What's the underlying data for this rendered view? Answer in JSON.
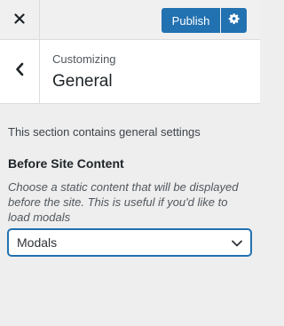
{
  "topbar": {
    "publish_label": "Publish",
    "close_icon": "close-icon",
    "settings_icon": "gear-icon",
    "accent_color": "#2271b1"
  },
  "section": {
    "breadcrumb": "Customizing",
    "title": "General",
    "back_icon": "chevron-left-icon"
  },
  "content": {
    "description": "This section contains general settings",
    "field_label": "Before Site Content",
    "field_help": "Choose a static content that will be displayed before the site. This is useful if you'd like to load modals",
    "select_value": "Modals"
  }
}
